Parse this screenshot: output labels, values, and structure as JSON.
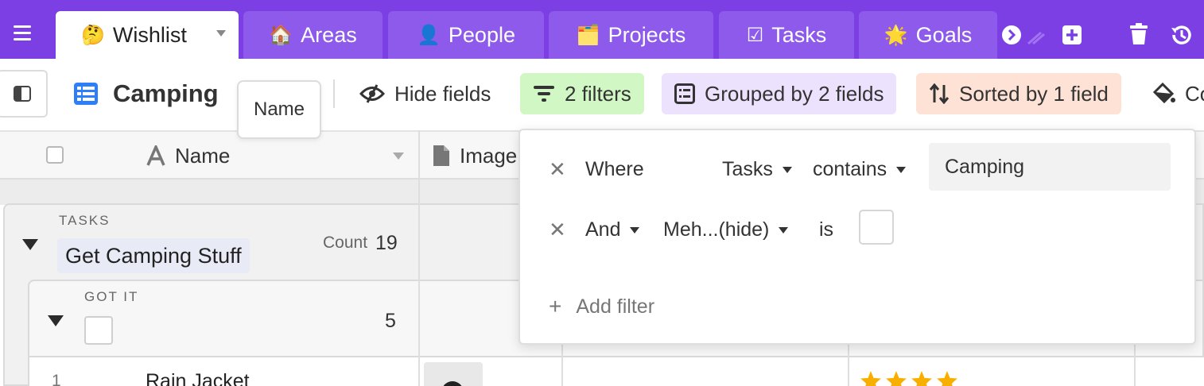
{
  "tabs": [
    {
      "emoji": "🤔",
      "label": "Wishlist",
      "active": true
    },
    {
      "emoji": "🏠",
      "label": "Areas"
    },
    {
      "emoji": "👤",
      "label": "People"
    },
    {
      "emoji": "🗂️",
      "label": "Projects"
    },
    {
      "emoji": "☑",
      "label": "Tasks"
    },
    {
      "emoji": "🌟",
      "label": "Goals"
    }
  ],
  "top_icons": [
    "hamburger-menu-icon",
    "chevron-right-circle-icon",
    "plus-box-icon",
    "trash-icon",
    "history-icon"
  ],
  "toolbar": {
    "view_name": "Camping",
    "tooltip": "Name",
    "hide_fields": "Hide fields",
    "filters": "2 filters",
    "grouped": "Grouped by 2 fields",
    "sorted": "Sorted by 1 field",
    "color_partial": "Co"
  },
  "colors": {
    "accent": "#7b3fe4",
    "filters_bg": "#d1f7c4",
    "grouped_bg": "#ede2fe",
    "sorted_bg": "#fee2d5",
    "grid_icon": "#2d7ff9",
    "star": "#f8b000"
  },
  "grid": {
    "columns": [
      {
        "label": "Name",
        "icon": "letter-a-icon"
      },
      {
        "label": "Image",
        "icon": "file-icon"
      }
    ],
    "group1": {
      "field": "TASKS",
      "value": "Get Camping Stuff",
      "count_label": "Count",
      "count": "19"
    },
    "group2": {
      "field": "GOT IT",
      "count": "5"
    },
    "rows": [
      {
        "index": "1",
        "name": "Rain Jacket",
        "rating": 4
      }
    ]
  },
  "filter_panel": {
    "conditions": [
      {
        "conjunction": "Where",
        "field": "Tasks",
        "operator": "contains",
        "value": "Camping"
      },
      {
        "conjunction": "And",
        "field": "Meh...(hide)",
        "operator": "is",
        "value_checkbox": false
      }
    ],
    "add_filter": "Add filter"
  }
}
